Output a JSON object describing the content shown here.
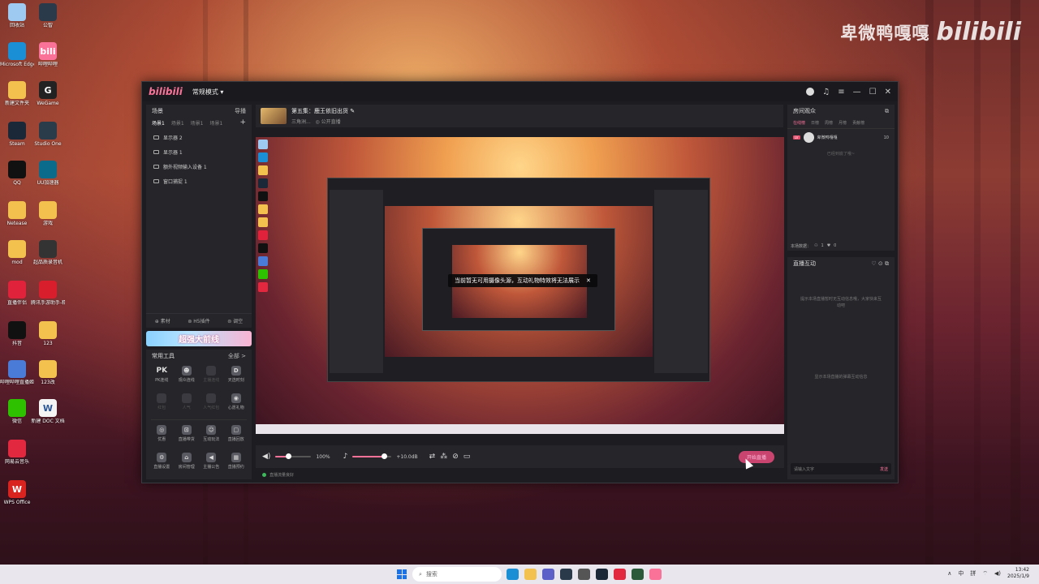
{
  "watermark": {
    "text": "卑微鸭嘎嘎",
    "logo": "bilibili"
  },
  "desktop_icons": [
    {
      "label": "回收站",
      "color": "#9ec9f0",
      "glyph": ""
    },
    {
      "label": "公智",
      "color": "#2a3a4a",
      "glyph": ""
    },
    {
      "label": "Microsoft Edge",
      "color": "#1a8fd6",
      "glyph": ""
    },
    {
      "label": "哔哩哔哩",
      "color": "#fb7299",
      "glyph": "bili"
    },
    {
      "label": "新建文件夹",
      "color": "#f2c14e",
      "glyph": ""
    },
    {
      "label": "WeGame",
      "color": "#222",
      "glyph": "G"
    },
    {
      "label": "Steam",
      "color": "#1b2838",
      "glyph": ""
    },
    {
      "label": "Studio One",
      "color": "#2a3c4a",
      "glyph": ""
    },
    {
      "label": "QQ",
      "color": "#111",
      "glyph": ""
    },
    {
      "label": "UU加速器",
      "color": "#0a6b8a",
      "glyph": ""
    },
    {
      "label": "Netease",
      "color": "#f2c14e",
      "glyph": ""
    },
    {
      "label": "游戏",
      "color": "#f2c14e",
      "glyph": ""
    },
    {
      "label": "mod",
      "color": "#f2c14e",
      "glyph": ""
    },
    {
      "label": "超品质录音机",
      "color": "#333",
      "glyph": ""
    },
    {
      "label": "直播伴侣",
      "color": "#e0223a",
      "glyph": ""
    },
    {
      "label": "腾讯手游助手-精明手...",
      "color": "#d81e2c",
      "glyph": ""
    },
    {
      "label": "抖音",
      "color": "#111",
      "glyph": ""
    },
    {
      "label": "123",
      "color": "#f2c14e",
      "glyph": ""
    },
    {
      "label": "哔哩哔哩直播姬",
      "color": "#4a7bd6",
      "glyph": ""
    },
    {
      "label": "123改",
      "color": "#f2c14e",
      "glyph": ""
    },
    {
      "label": "微信",
      "color": "#2dc100",
      "glyph": ""
    },
    {
      "label": "新建 DOC 文档",
      "color": "#f4f4f4",
      "glyph": "W"
    },
    {
      "label": "网易云音乐",
      "color": "#e1283e",
      "glyph": ""
    },
    {
      "label": "WPS Office",
      "color": "#d8231f",
      "glyph": "W"
    }
  ],
  "app": {
    "logo": "bilibili",
    "mode": "常规模式 ▾",
    "scene_panel": {
      "title": "场景",
      "import_label": "导播",
      "tabs": [
        "场景1",
        "场景1",
        "场景1",
        "场景1"
      ],
      "sources": [
        "显示器 2",
        "显示器 1",
        "额外视频输入设备 1",
        "窗口捕捉 1"
      ],
      "footer": [
        "素材",
        "H5插件",
        "调空"
      ]
    },
    "banner_text": "超强大前线",
    "tools": {
      "title": "常用工具",
      "all_label": "全部 >",
      "items": [
        {
          "label": "PK连线",
          "glyph": "PK",
          "dim": false
        },
        {
          "label": "观众连线",
          "glyph": "☻",
          "dim": false
        },
        {
          "label": "主播连线",
          "glyph": "",
          "dim": true
        },
        {
          "label": "天选时刻",
          "glyph": "D",
          "dim": false
        },
        {
          "label": "红包",
          "glyph": "",
          "dim": true
        },
        {
          "label": "人气",
          "glyph": "",
          "dim": true
        },
        {
          "label": "人气红包",
          "glyph": "",
          "dim": true
        },
        {
          "label": "心愿礼物",
          "glyph": "◉",
          "dim": false
        },
        {
          "label": "优惠",
          "glyph": "◎",
          "dim": false
        },
        {
          "label": "直播带货",
          "glyph": "⊡",
          "dim": false
        },
        {
          "label": "互动玩法",
          "glyph": "☺",
          "dim": false
        },
        {
          "label": "直播回放",
          "glyph": "▢",
          "dim": false
        },
        {
          "label": "直播设置",
          "glyph": "⚙",
          "dim": false
        },
        {
          "label": "房间管理",
          "glyph": "⌂",
          "dim": false
        },
        {
          "label": "主播公告",
          "glyph": "◀",
          "dim": false
        },
        {
          "label": "直播预约",
          "glyph": "▦",
          "dim": false
        }
      ]
    },
    "stream": {
      "title": "第五集：鹿王依旧出货",
      "category": "三角洲...",
      "visibility": "公开直播"
    },
    "preview_toast": "当前暂无可用摄像头源，互动礼物特效将无法展示",
    "controls": {
      "speaker_volume": 0.35,
      "speaker_percent": "100%",
      "mic_volume": 0.8,
      "mic_level": "+10.0dB",
      "start_label": "开始直播",
      "status": "直播流量良好"
    },
    "audience": {
      "title": "房间观众",
      "tabs": [
        "在线榜",
        "日榜",
        "周榜",
        "月榜",
        "贡献榜"
      ],
      "viewer": {
        "badge": "LV",
        "name": "卑微鸭嘎嘎",
        "count": "10"
      },
      "no_more": "已经到底了哦~",
      "room_data_label": "本场数据：",
      "room_data_values": [
        "1",
        "0"
      ]
    },
    "interaction": {
      "title": "直播互动",
      "tip": "提示本场直播暂时无互动信息哦，大家快来互动吧",
      "tip2": "显示本场直播的弹幕互动信息",
      "input_placeholder": "请输入文字",
      "send_label": "发送"
    }
  },
  "taskbar": {
    "search_placeholder": "搜索",
    "time": "13:42",
    "date": "2025/1/9",
    "tray": [
      "∧",
      "中",
      "拼"
    ]
  }
}
